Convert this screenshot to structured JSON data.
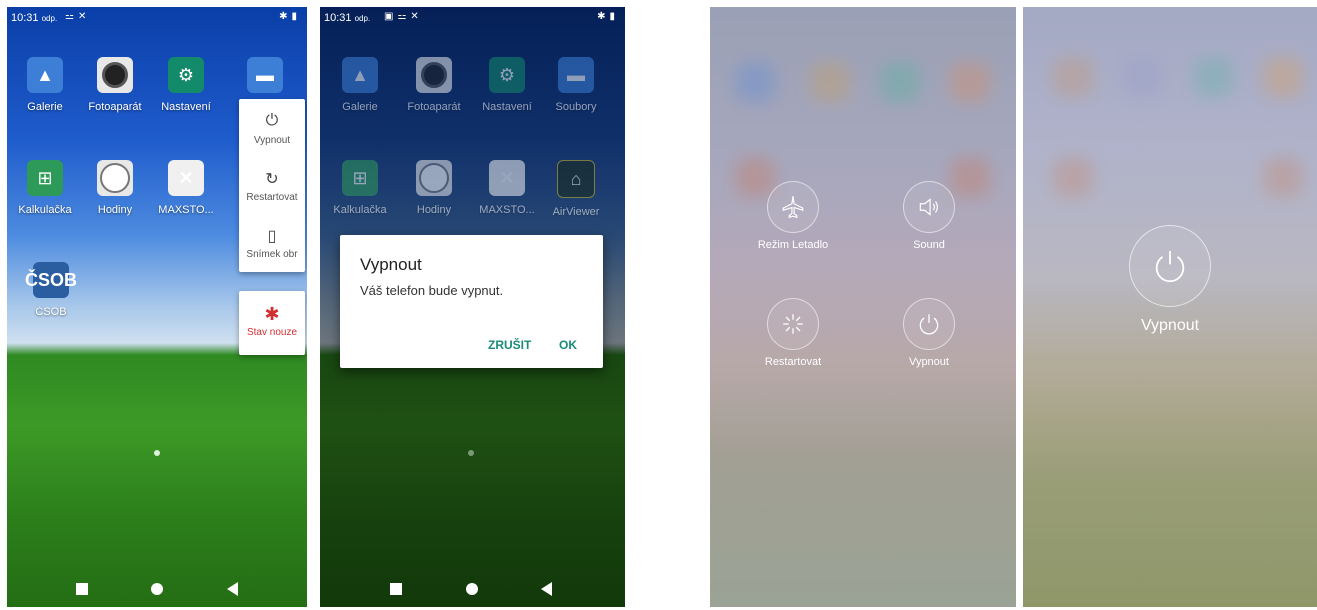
{
  "screen1": {
    "status": {
      "time": "10:31",
      "suffix": "odp."
    },
    "apps_row1": [
      "Galerie",
      "Fotoaparát",
      "Nastavení"
    ],
    "apps_row2": [
      "Kalkulačka",
      "Hodiny",
      "MAXSTO..."
    ],
    "apps_row3": [
      "ČSOB"
    ],
    "csob_icon_text": "ČSOB",
    "power_menu": {
      "items": [
        {
          "label": "Vypnout",
          "icon": "power-icon"
        },
        {
          "label": "Restartovat",
          "icon": "restart-icon"
        },
        {
          "label": "Snímek obr",
          "icon": "screenshot-icon"
        }
      ],
      "emergency": {
        "label": "Stav nouze",
        "icon": "asterisk-icon",
        "color": "#d32f2f"
      }
    }
  },
  "screen2": {
    "status": {
      "time": "10:31",
      "suffix": "odp."
    },
    "apps_row1": [
      "Galerie",
      "Fotoaparát",
      "Nastavení",
      "Soubory"
    ],
    "apps_row2": [
      "Kalkulačka",
      "Hodiny",
      "MAXSTO...",
      "AirViewer"
    ],
    "dialog": {
      "title": "Vypnout",
      "message": "Váš telefon bude vypnut.",
      "cancel": "ZRUŠIT",
      "ok": "OK",
      "button_color": "#1b8a7a"
    }
  },
  "screen3": {
    "buttons": [
      {
        "label": "Režim Letadlo",
        "icon": "airplane-icon"
      },
      {
        "label": "Sound",
        "icon": "speaker-icon"
      },
      {
        "label": "Restartovat",
        "icon": "loading-icon"
      },
      {
        "label": "Vypnout",
        "icon": "power-icon"
      }
    ]
  },
  "screen4": {
    "power": {
      "label": "Vypnout",
      "icon": "power-icon"
    }
  }
}
